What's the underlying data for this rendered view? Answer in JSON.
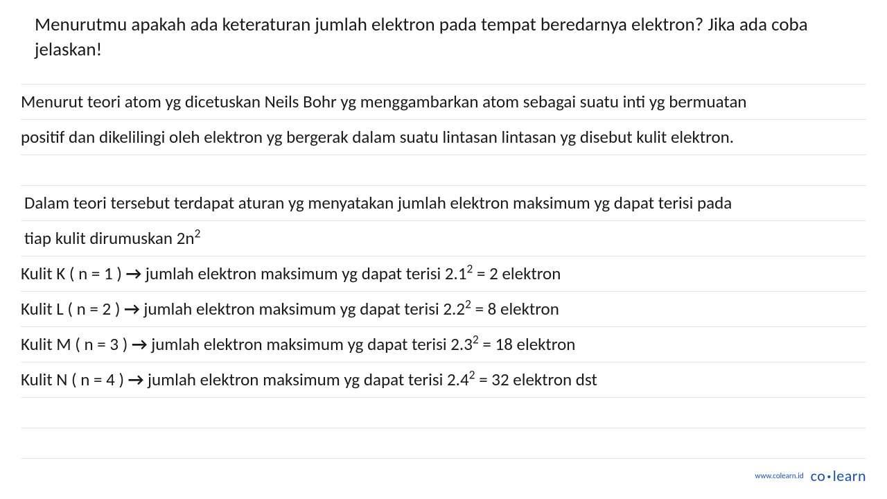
{
  "question": "Menurutmu apakah ada keteraturan jumlah elektron pada tempat beredarnya elektron? Jika ada coba jelaskan!",
  "paragraph1_line1": "Menurut teori atom yg dicetuskan Neils Bohr yg menggambarkan atom sebagai suatu inti yg bermuatan",
  "paragraph1_line2": "positif dan dikelilingi oleh elektron yg bergerak dalam suatu lintasan lintasan yg disebut kulit elektron.",
  "paragraph2_line1": "Dalam teori tersebut terdapat aturan yg menyatakan jumlah elektron maksimum yg dapat terisi pada",
  "paragraph2_line2_prefix": "tiap kulit dirumuskan 2n",
  "shellK_prefix": "Kulit K ( n = 1 ) ",
  "shellK_mid": " jumlah elektron maksimum yg dapat terisi 2.1",
  "shellK_suffix": " = 2 elektron",
  "shellL_prefix": "Kulit L ( n = 2 ) ",
  "shellL_mid": " jumlah elektron maksimum yg dapat terisi 2.2",
  "shellL_suffix": " = 8 elektron",
  "shellM_prefix": "Kulit M ( n = 3 ) ",
  "shellM_mid": " jumlah elektron maksimum yg dapat terisi 2.3",
  "shellM_suffix": " = 18 elektron",
  "shellN_prefix": "Kulit N ( n = 4 ) ",
  "shellN_mid": " jumlah elektron maksimum yg dapat terisi 2.4",
  "shellN_suffix": " = 32 elektron dst",
  "arrow": "→",
  "sup2": "2",
  "footer_url": "www.colearn.id",
  "brand_co": "co",
  "brand_learn": "learn"
}
